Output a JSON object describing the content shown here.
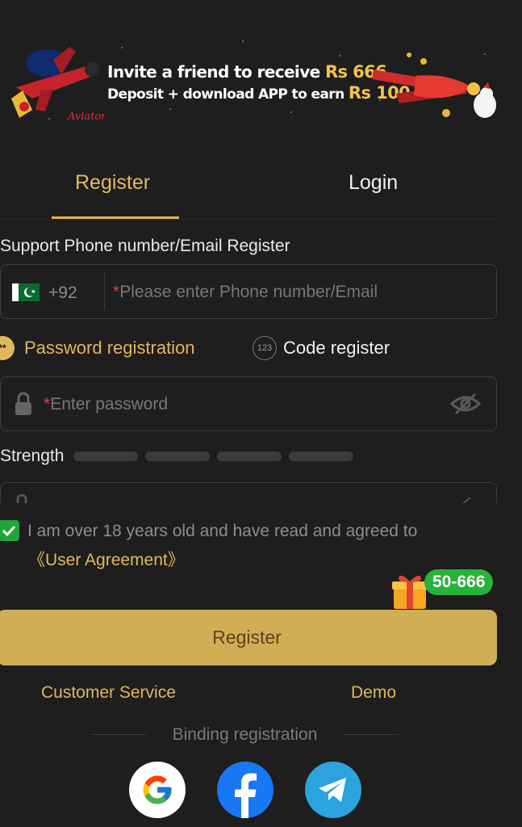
{
  "banner": {
    "line1_text": "Invite a friend to receive",
    "line1_amount": "Rs 666",
    "line2_text": "Deposit + download APP to earn",
    "line2_amount": "Rs 100",
    "logo_text": "Aviator"
  },
  "tabs": [
    {
      "label": "Register",
      "active": true
    },
    {
      "label": "Login",
      "active": false
    }
  ],
  "form": {
    "section_label": "Support Phone number/Email Register",
    "country_code": "+92",
    "phone_placeholder": "Please enter Phone number/Email",
    "required_mark": "*",
    "options": {
      "password_label": "Password registration",
      "password_icon": "**",
      "code_label": "Code register",
      "code_icon": "123"
    },
    "password_placeholder": "Enter password",
    "strength_label": "Strength",
    "agree_text": "I am over 18 years old and have read and agreed to",
    "agreement_link": "《User Agreement》",
    "agree_checked": true,
    "register_button": "Register"
  },
  "gift_badge": "50-666",
  "links": {
    "customer_service": "Customer Service",
    "demo": "Demo"
  },
  "binding_label": "Binding registration",
  "social": [
    "google-icon",
    "facebook-icon",
    "telegram-icon"
  ],
  "colors": {
    "background": "#1e1e1e",
    "accent": "#e1b65d",
    "button": "#cfae55",
    "success": "#27b33a"
  }
}
